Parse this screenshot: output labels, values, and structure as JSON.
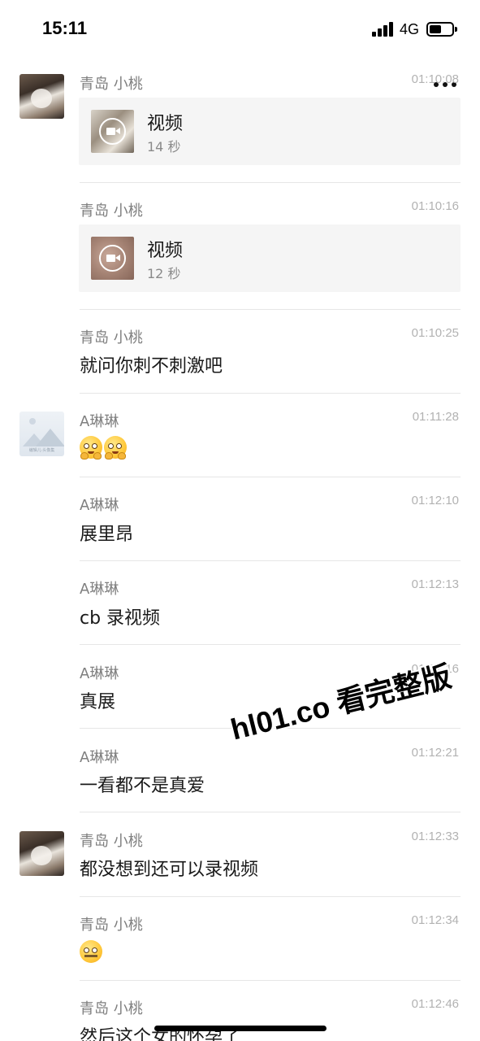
{
  "status_bar": {
    "time": "15:11",
    "network": "4G"
  },
  "messages": [
    {
      "name": "青岛 小桃",
      "time": "01:10:08",
      "video_title": "视频",
      "video_duration": "14 秒"
    },
    {
      "name": "青岛 小桃",
      "time": "01:10:16",
      "video_title": "视频",
      "video_duration": "12 秒"
    },
    {
      "name": "青岛 小桃",
      "time": "01:10:25",
      "text": "就问你刺不刺激吧"
    },
    {
      "name": "A琳琳",
      "time": "01:11:28",
      "avatar_caption": "编辑儿·头像集"
    },
    {
      "name": "A琳琳",
      "time": "01:12:10",
      "text": "展里昂"
    },
    {
      "name": "A琳琳",
      "time": "01:12:13",
      "text": "cb 录视频"
    },
    {
      "name": "A琳琳",
      "time": "01:12:16",
      "text": "真展"
    },
    {
      "name": "A琳琳",
      "time": "01:12:21",
      "text": "一看都不是真爱"
    },
    {
      "name": "青岛 小桃",
      "time": "01:12:33",
      "text": "都没想到还可以录视频"
    },
    {
      "name": "青岛 小桃",
      "time": "01:12:34"
    },
    {
      "name": "青岛 小桃",
      "time": "01:12:46",
      "text": "然后这个女的怀孕了"
    }
  ],
  "watermark": "hl01.co 看完整版"
}
